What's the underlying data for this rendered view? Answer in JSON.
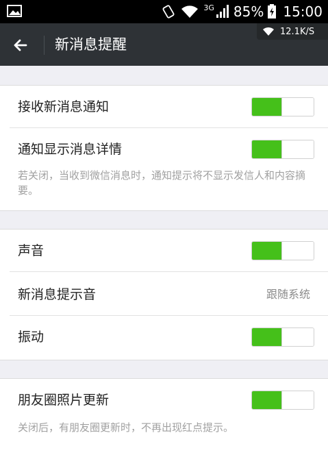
{
  "status_bar": {
    "network": "3G",
    "battery": "85%",
    "time": "15:00"
  },
  "net_speed": "12.1K/S",
  "header": {
    "title": "新消息提醒"
  },
  "group1": {
    "receive": {
      "label": "接收新消息通知",
      "toggle_on": true
    },
    "detail": {
      "label": "通知显示消息详情",
      "toggle_on": true
    },
    "detail_desc": "若关闭，当收到微信消息时，通知提示将不显示发信人和内容摘要。"
  },
  "group2": {
    "sound": {
      "label": "声音",
      "toggle_on": true
    },
    "tone": {
      "label": "新消息提示音",
      "value": "跟随系统"
    },
    "vibrate": {
      "label": "振动",
      "toggle_on": true
    }
  },
  "group3": {
    "moments": {
      "label": "朋友圈照片更新",
      "toggle_on": true
    },
    "moments_desc": "关闭后，有朋友圈更新时，不再出现红点提示。"
  },
  "colors": {
    "toggle_on": "#45c01a",
    "title_bar": "#2e3236"
  }
}
